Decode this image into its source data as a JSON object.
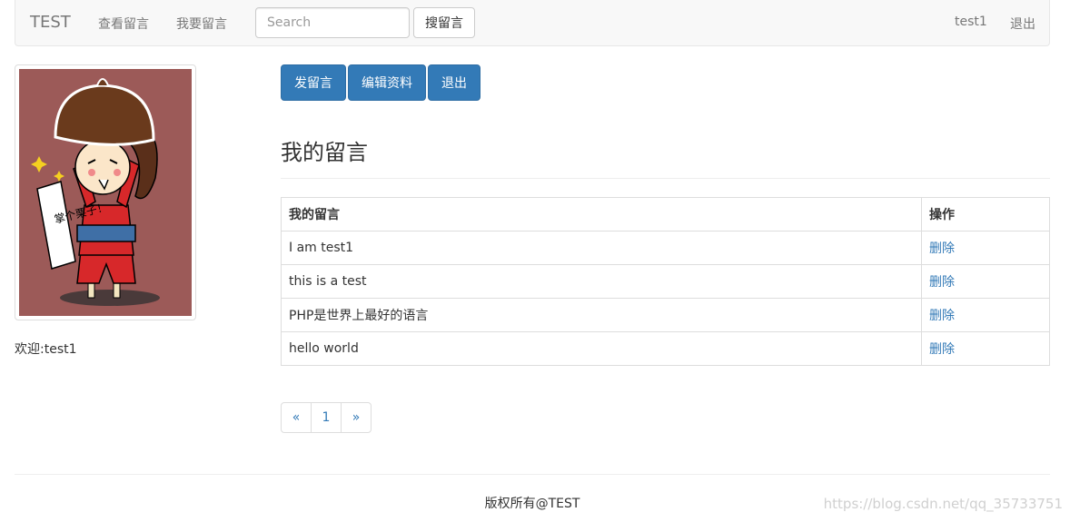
{
  "navbar": {
    "brand": "TEST",
    "links": [
      "查看留言",
      "我要留言"
    ],
    "search_placeholder": "Search",
    "search_button": "搜留言",
    "user": "test1",
    "logout": "退出"
  },
  "sidebar": {
    "avatar_caption": "掌个栗子！",
    "welcome": "欢迎:test1"
  },
  "actions": {
    "post": "发留言",
    "edit_profile": "编辑资料",
    "logout": "退出"
  },
  "main": {
    "title": "我的留言",
    "table": {
      "headers": [
        "我的留言",
        "操作"
      ],
      "rows": [
        {
          "message": "I am test1",
          "action": "删除"
        },
        {
          "message": "this is a test",
          "action": "删除"
        },
        {
          "message": "PHP是世界上最好的语言",
          "action": "删除"
        },
        {
          "message": "hello world",
          "action": "删除"
        }
      ]
    }
  },
  "pagination": {
    "prev": "«",
    "current": "1",
    "next": "»"
  },
  "footer": {
    "text": "版权所有@TEST"
  },
  "watermark": "https://blog.csdn.net/qq_35733751",
  "colors": {
    "primary": "#337ab7",
    "avatar_bg": "#9c5a58",
    "navbar_bg": "#f8f8f8"
  }
}
